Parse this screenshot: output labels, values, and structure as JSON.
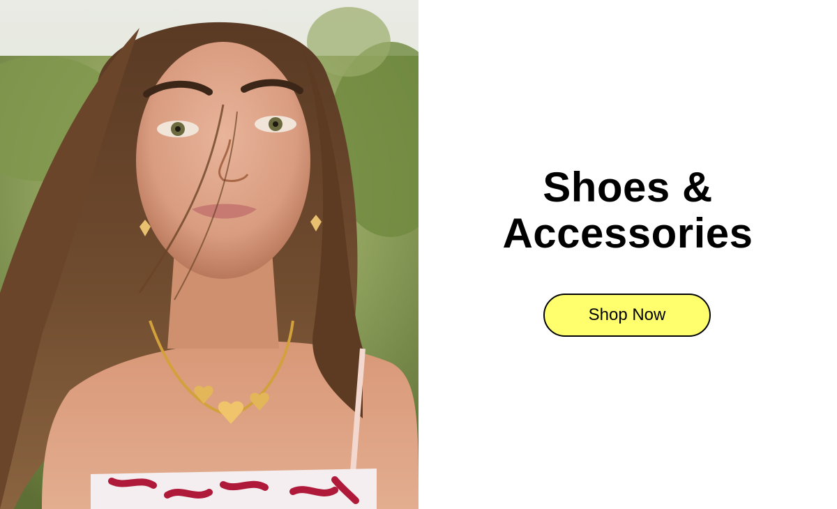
{
  "banner": {
    "headline_line1": "Shoes &",
    "headline_line2": "Accessories",
    "cta_label": "Shop Now",
    "photo_alt": "Model wearing gold heart necklace and earrings"
  },
  "colors": {
    "cta_background": "#ffff6e",
    "cta_border": "#000000",
    "headline": "#000000",
    "page_background": "#ffffff"
  }
}
